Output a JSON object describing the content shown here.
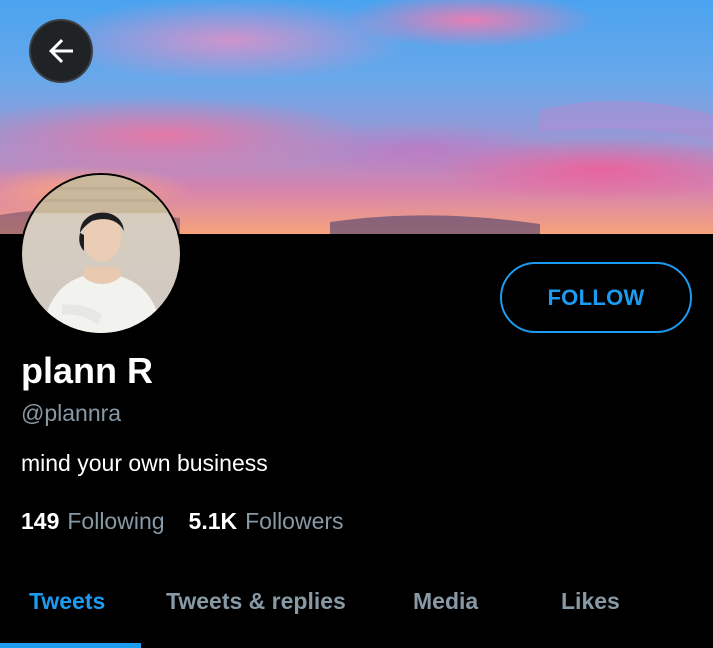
{
  "header": {
    "back_icon": "arrow-left-icon"
  },
  "profile": {
    "name": "plann R",
    "handle": "@plannra",
    "bio": "mind your own business",
    "follow_label": "FOLLOW"
  },
  "stats": {
    "following_count": "149",
    "following_label": "Following",
    "followers_count": "5.1K",
    "followers_label": "Followers"
  },
  "tabs": [
    {
      "label": "Tweets",
      "active": true
    },
    {
      "label": "Tweets & replies",
      "active": false
    },
    {
      "label": "Media",
      "active": false
    },
    {
      "label": "Likes",
      "active": false
    }
  ],
  "colors": {
    "accent": "#1d9bf0",
    "background": "#000000",
    "secondary_text": "#8899a6"
  }
}
